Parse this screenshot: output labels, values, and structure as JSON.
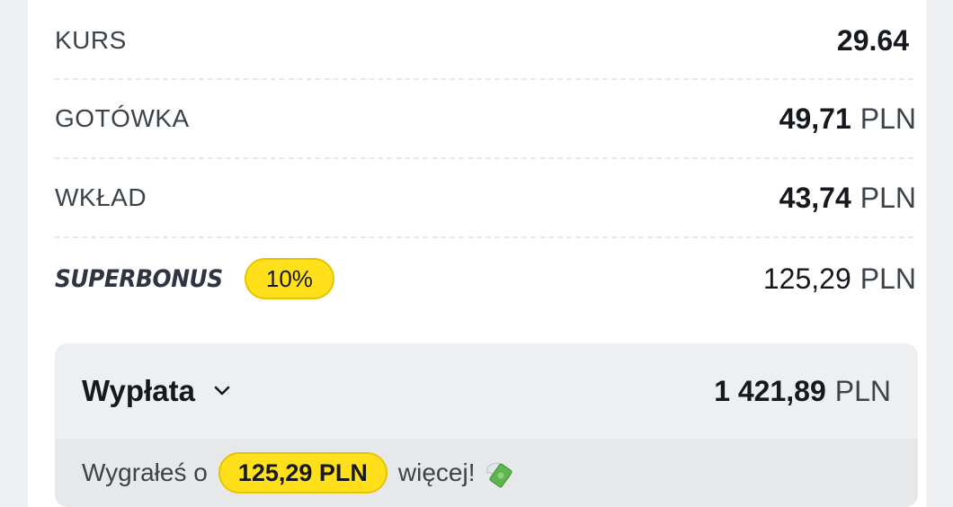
{
  "rows": {
    "kurs": {
      "label": "KURS",
      "value": "29.64"
    },
    "gotowka": {
      "label": "GOTÓWKA",
      "amount": "49,71",
      "currency": "PLN"
    },
    "wklad": {
      "label": "WKŁAD",
      "amount": "43,74",
      "currency": "PLN"
    },
    "superbonus": {
      "label": "SUPERBONUS",
      "badge": "10%",
      "amount": "125,29",
      "currency": "PLN"
    }
  },
  "payout": {
    "title": "Wypłata",
    "amount": "1 421,89",
    "currency": "PLN",
    "note_prefix": "Wygrałeś o",
    "note_badge": "125,29 PLN",
    "note_suffix": "więcej!",
    "note_icon": "money-with-wings-icon"
  },
  "colors": {
    "accent_yellow": "#ffe01b",
    "text_dark": "#15191e",
    "text_muted": "#3d434a",
    "panel_bg": "#eeeff1"
  }
}
